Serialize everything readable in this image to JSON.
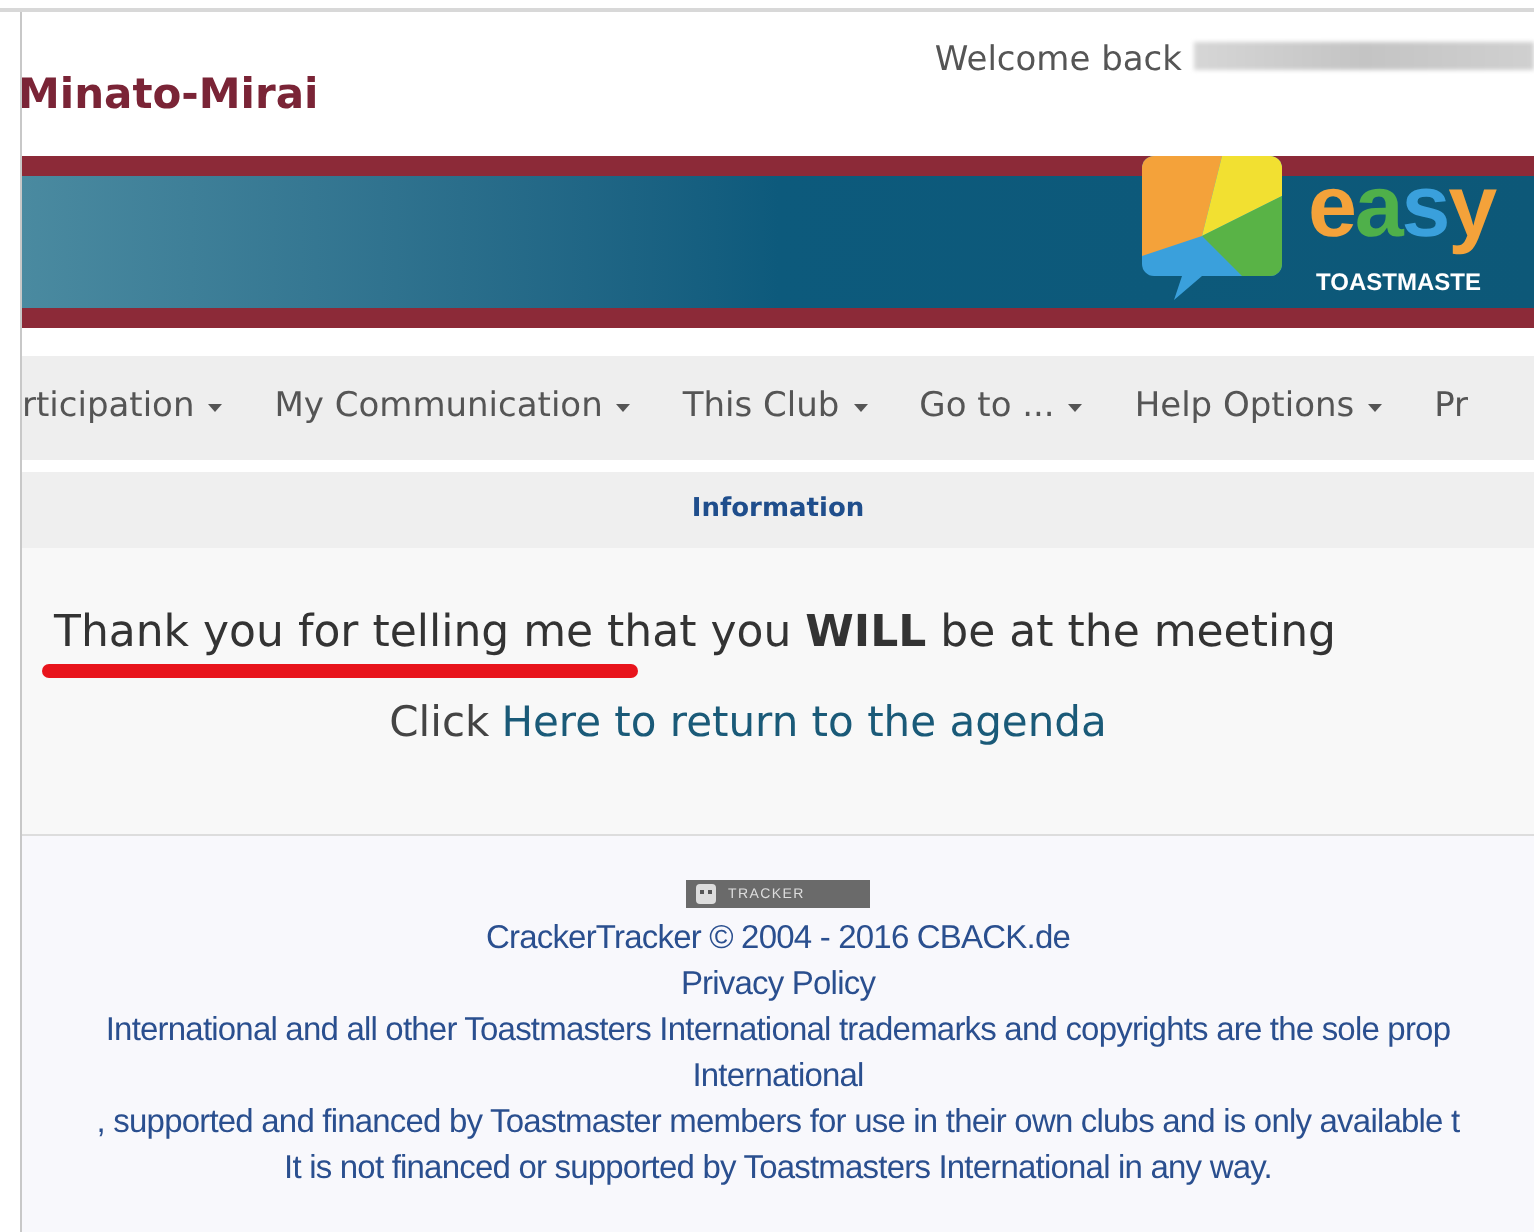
{
  "header": {
    "club_name": "Minato-Mirai",
    "welcome": "Welcome back"
  },
  "banner": {
    "logo_word": "easy",
    "logo_tagline": "TOASTMASTE"
  },
  "nav": [
    {
      "label": "rticipation",
      "has_menu": true
    },
    {
      "label": "My Communication",
      "has_menu": true
    },
    {
      "label": "This Club",
      "has_menu": true
    },
    {
      "label": "Go to ...",
      "has_menu": true
    },
    {
      "label": "Help Options",
      "has_menu": true
    },
    {
      "label": "Pr",
      "has_menu": false
    }
  ],
  "info_bar": {
    "title": "Information"
  },
  "message": {
    "text": "Thank you for telling me that you **WILL** be at the meeting",
    "underlined": true
  },
  "return_link": {
    "prefix": "Click",
    "link": "Here to return to the agenda"
  },
  "footer": {
    "badge": "TRACKER",
    "lines": [
      "CrackerTracker © 2004 - 2016 CBACK.de",
      "Privacy Policy",
      "International and all other Toastmasters International trademarks and copyrights are the sole prop",
      "International",
      ", supported and financed by Toastmaster members for use in their own clubs and is only available t",
      "It is not financed or supported by Toastmasters International in any way."
    ]
  }
}
